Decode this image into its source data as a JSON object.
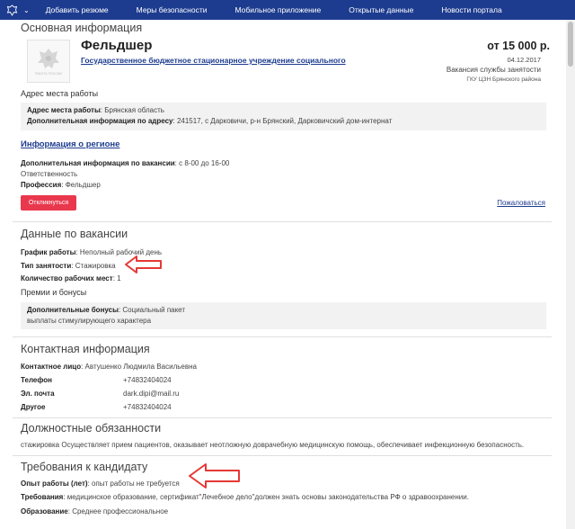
{
  "nav": {
    "items": [
      "Добавить резюме",
      "Меры безопасности",
      "Мобильное приложение",
      "Открытые данные",
      "Новости портала"
    ]
  },
  "main_info": {
    "section_title": "Основная информация",
    "logo_text": "РАБОТА РОССИИ",
    "job_title": "Фельдшер",
    "org_name": "Государственное бюджетное стационарное учреждение социального",
    "salary": "от 15 000 р.",
    "date": "04.12.2017",
    "vacancy_source": "Вакансия службы занятости",
    "employment_center": "ГКУ ЦЗН Брянского района"
  },
  "address": {
    "title": "Адрес места работы",
    "address_label": "Адрес места работы",
    "address_value": "Брянская область",
    "extra_label": "Дополнительная информация по адресу",
    "extra_value": "241517, с Дарковичи, р-н Брянский, Дарковичский дом-интернат"
  },
  "region": {
    "link_label": "Информация о регионе"
  },
  "vacancy_extra": {
    "label": "Дополнительная информация по вакансии",
    "value": "с 8-00 до 16-00",
    "responsibility": "Ответственность",
    "profession_label": "Профессия",
    "profession_value": "Фельдшер"
  },
  "actions": {
    "respond_label": "Откликнуться",
    "complain_label": "Пожаловаться"
  },
  "vacancy_data": {
    "section_title": "Данные по вакансии",
    "schedule_label": "График работы",
    "schedule_value": "Неполный рабочий день",
    "employment_type_label": "Тип занятости",
    "employment_type_value": "Стажировка",
    "workplaces_label": "Количество рабочих мест",
    "workplaces_value": "1",
    "bonuses_title": "Премии и бонусы",
    "extra_bonuses_label": "Дополнительные бонусы",
    "extra_bonuses_value": "Социальный пакет",
    "extra_bonuses_line2": "выплаты стимулирующего характера"
  },
  "contacts": {
    "section_title": "Контактная информация",
    "person_label": "Контактное лицо",
    "person_value": "Автушенко Людмила Васильевна",
    "phone_label": "Телефон",
    "phone_value": "+74832404024",
    "email_label": "Эл. почта",
    "email_value": "dark.dipi@mail.ru",
    "other_label": "Другое",
    "other_value": "+74832404024"
  },
  "duties": {
    "section_title": "Должностные обязанности",
    "text": "стажировка Осуществляет прием пациентов, оказывает неотложную доврачебную медицинскую помощь, обеспечивает инфекционную безопасность."
  },
  "requirements": {
    "section_title": "Требования к кандидату",
    "experience_label": "Опыт работы (лет)",
    "experience_value": "опыт работы не требуется",
    "req_label": "Требования",
    "req_value": "медицинское образование, сертификат\"Лечебное дело\"должен знать основы законодательства РФ о здравоохранении.",
    "education_label": "Образование",
    "education_value": "Среднее профессиональное"
  },
  "colors": {
    "nav_bg": "#1d3c8f",
    "respond_button": "#e9384d",
    "annotation_arrow": "#e53935"
  }
}
